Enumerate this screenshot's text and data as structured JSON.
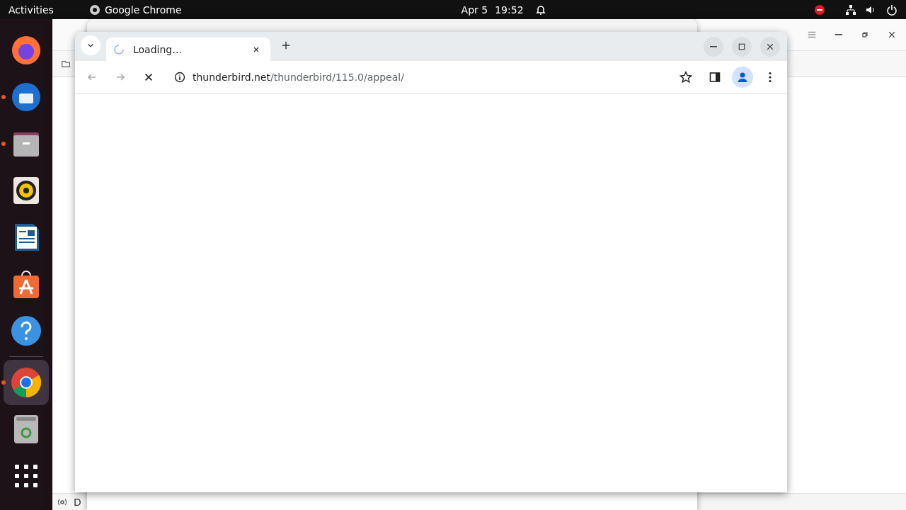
{
  "top_bar": {
    "activities": "Activities",
    "app_name": "Google Chrome",
    "date": "Apr 5",
    "time": "19:52"
  },
  "dock": {
    "items": [
      {
        "kind": "firefox",
        "running": false,
        "focused": false
      },
      {
        "kind": "thunderbird",
        "running": true,
        "focused": false
      },
      {
        "kind": "files",
        "running": true,
        "focused": false
      },
      {
        "kind": "rhythmbox",
        "running": false,
        "focused": false
      },
      {
        "kind": "writer",
        "running": false,
        "focused": false
      },
      {
        "kind": "software",
        "running": false,
        "focused": false
      },
      {
        "kind": "help",
        "running": false,
        "focused": false
      },
      {
        "kind": "separator"
      },
      {
        "kind": "chrome",
        "running": true,
        "focused": true
      },
      {
        "kind": "trash",
        "running": false,
        "focused": false
      },
      {
        "kind": "apps",
        "running": false,
        "focused": false
      }
    ]
  },
  "mail_window": {
    "status_text": "D"
  },
  "browser": {
    "tab": {
      "title": "Loading…",
      "loading": true
    },
    "address": {
      "host": "thunderbird.net",
      "path": "/thunderbird/115.0/appeal/"
    }
  }
}
